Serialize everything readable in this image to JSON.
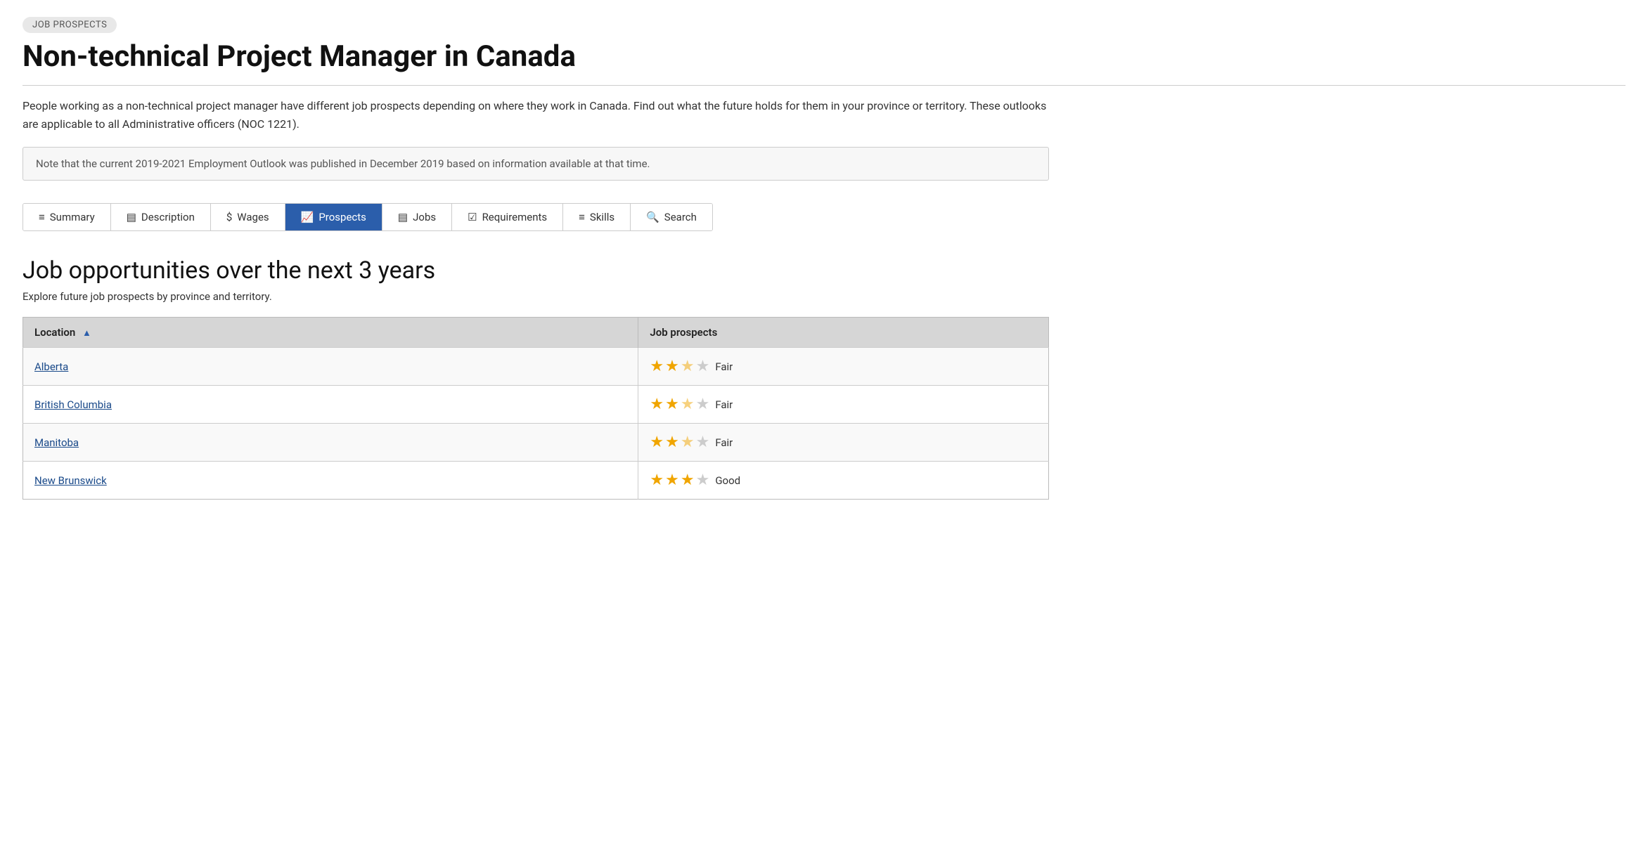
{
  "badge": "JOB PROSPECTS",
  "main_title": "Non-technical Project Manager in Canada",
  "divider": true,
  "description": "People working as a non-technical project manager have different job prospects depending on where they work in Canada. Find out what the future holds for them in your province or territory. These outlooks are applicable to all Administrative officers (NOC 1221).",
  "notice": "Note that the current 2019-2021 Employment Outlook was published in December 2019 based on information available at that time.",
  "tabs": [
    {
      "id": "summary",
      "label": "Summary",
      "icon": "≡",
      "active": false
    },
    {
      "id": "description",
      "label": "Description",
      "icon": "▤",
      "active": false
    },
    {
      "id": "wages",
      "label": "Wages",
      "icon": "$",
      "active": false
    },
    {
      "id": "prospects",
      "label": "Prospects",
      "icon": "📈",
      "active": true
    },
    {
      "id": "jobs",
      "label": "Jobs",
      "icon": "▤",
      "active": false
    },
    {
      "id": "requirements",
      "label": "Requirements",
      "icon": "✓",
      "active": false
    },
    {
      "id": "skills",
      "label": "Skills",
      "icon": "≡",
      "active": false
    },
    {
      "id": "search",
      "label": "Search",
      "icon": "🔍",
      "active": false
    }
  ],
  "section_title": "Job opportunities over the next 3 years",
  "section_subtitle": "Explore future job prospects by province and territory.",
  "table": {
    "columns": [
      {
        "id": "location",
        "label": "Location",
        "sortable": true
      },
      {
        "id": "job_prospects",
        "label": "Job prospects",
        "sortable": false
      }
    ],
    "rows": [
      {
        "location": "Alberta",
        "stars": 2.5,
        "label": "Fair"
      },
      {
        "location": "British Columbia",
        "stars": 2.5,
        "label": "Fair"
      },
      {
        "location": "Manitoba",
        "stars": 2.5,
        "label": "Fair"
      },
      {
        "location": "New Brunswick",
        "stars": 3,
        "label": "Good"
      }
    ]
  }
}
